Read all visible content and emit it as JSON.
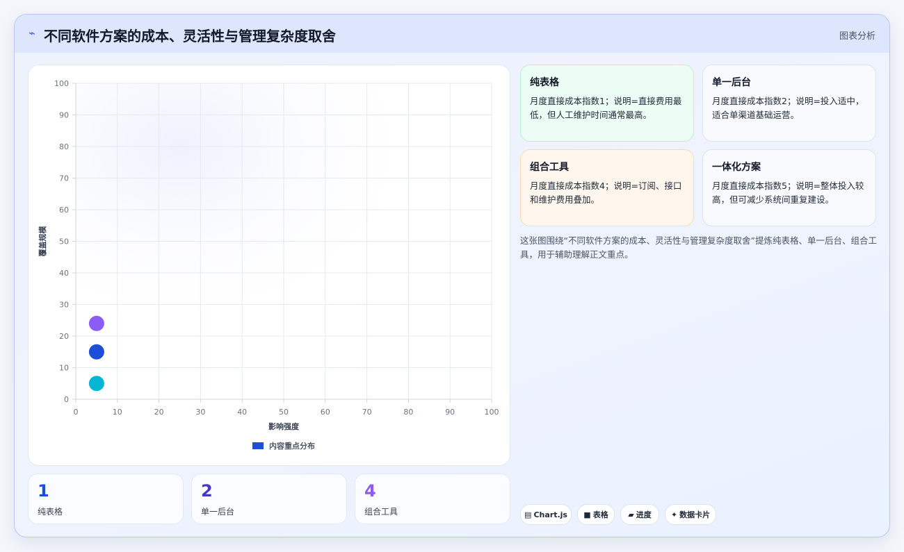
{
  "header": {
    "icon": "bolt-icon",
    "title": "不同软件方案的成本、灵活性与管理复杂度取舍",
    "tag": "图表分析"
  },
  "chart_data": {
    "type": "scatter",
    "xlabel": "影响强度",
    "ylabel": "覆盖规模",
    "xlim": [
      0,
      100
    ],
    "ylim": [
      0,
      100
    ],
    "xticks": [
      "0",
      "10",
      "20",
      "30",
      "40",
      "50",
      "60",
      "70",
      "80",
      "90",
      "100"
    ],
    "yticks": [
      "0",
      "10",
      "20",
      "30",
      "40",
      "50",
      "60",
      "70",
      "80",
      "90",
      "100"
    ],
    "grid": true,
    "legend": {
      "position": "bottom",
      "label": "内容重点分布",
      "color": "#1d4ed8"
    },
    "points": [
      {
        "x": 5,
        "y": 24,
        "color": "#8b5cf6"
      },
      {
        "x": 5,
        "y": 15,
        "color": "#1d4ed8"
      },
      {
        "x": 5,
        "y": 5,
        "color": "#06b6d4"
      }
    ]
  },
  "stats": [
    {
      "value": "1",
      "label": "纯表格",
      "color": "#1d4ed8"
    },
    {
      "value": "2",
      "label": "单一后台",
      "color": "#4338ca"
    },
    {
      "value": "4",
      "label": "组合工具",
      "color": "#8b5cf6"
    }
  ],
  "notes": [
    {
      "title": "纯表格",
      "text": "月度直接成本指数1；说明=直接费用最低，但人工维护时间通常最高。",
      "bg": "#ecfdf5",
      "border": "#bbf0d3"
    },
    {
      "title": "单一后台",
      "text": "月度直接成本指数2；说明=投入适中，适合单渠道基础运营。",
      "bg": "#f8fafe",
      "border": "#dbe3f3"
    },
    {
      "title": "组合工具",
      "text": "月度直接成本指数4；说明=订阅、接口和维护费用叠加。",
      "bg": "#fff7ed",
      "border": "#fbd9b0"
    },
    {
      "title": "一体化方案",
      "text": "月度直接成本指数5；说明=整体投入较高，但可减少系统间重复建设。",
      "bg": "#f8fafe",
      "border": "#dbe3f3"
    }
  ],
  "summary": "这张图围绕“不同软件方案的成本、灵活性与管理复杂度取舍”提炼纯表格、单一后台、组合工具，用于辅助理解正文重点。",
  "chips": [
    {
      "icon": "chart-icon",
      "glyph": "▤",
      "label": "Chart.js"
    },
    {
      "icon": "table-icon",
      "glyph": "■",
      "label": "表格"
    },
    {
      "icon": "progress-icon",
      "glyph": "▰",
      "label": "进度"
    },
    {
      "icon": "card-icon",
      "glyph": "✦",
      "label": "数据卡片"
    }
  ]
}
